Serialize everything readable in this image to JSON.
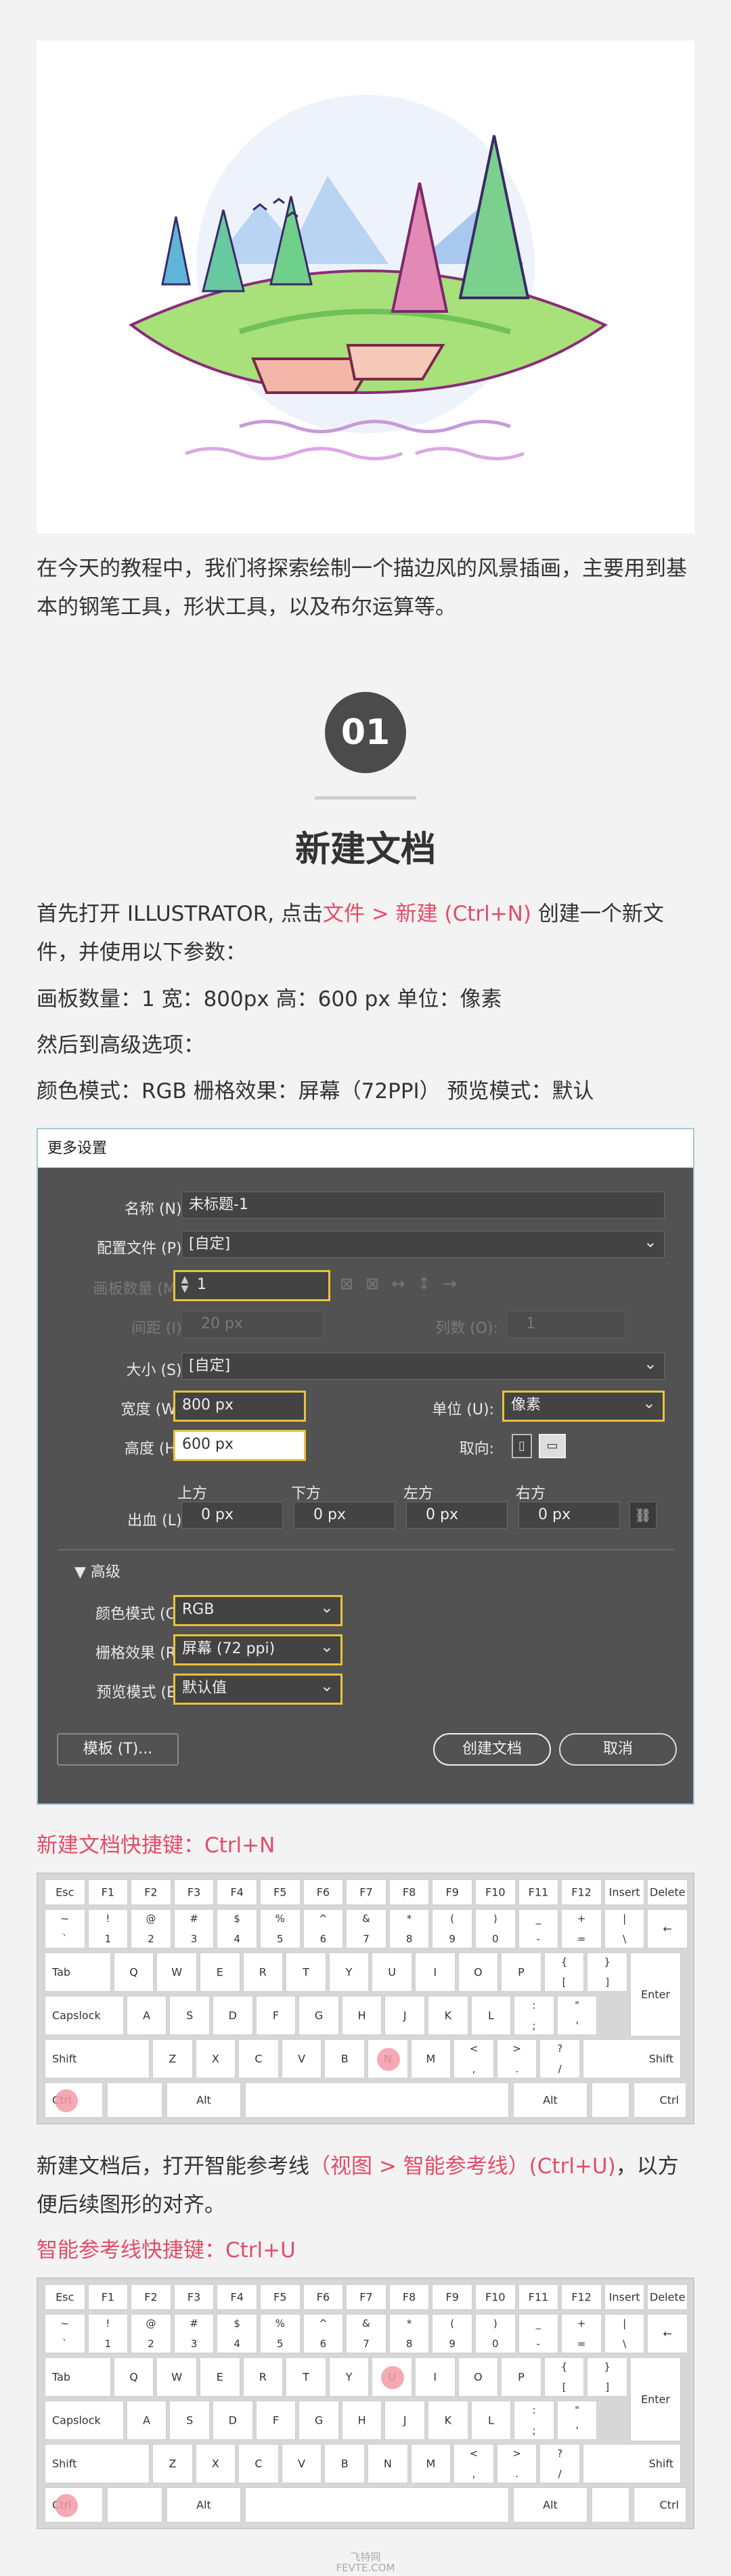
{
  "intro": "在今天的教程中，我们将探索绘制一个描边风的风景插画，主要用到基本的钢笔工具，形状工具，以及布尔运算等。",
  "step": {
    "number": "01",
    "title": "新建文档"
  },
  "para1": {
    "a": "首先打开 ILLUSTRATOR, 点击",
    "link": "文件 > 新建 (Ctrl+N)",
    "b": " 创建一个新文件，并使用以下参数："
  },
  "para2": "画板数量：1   宽：800px   高：600 px   单位：像素",
  "para3": "然后到高级选项：",
  "para4": "颜色模式：RGB   栅格效果：屏幕（72PPI）  预览模式：默认",
  "dialog": {
    "title": "更多设置",
    "name_label": "名称 (N):",
    "name_value": "未标题-1",
    "profile_label": "配置文件 (P):",
    "profile_value": "[自定]",
    "artboards_label": "画板数量 (M):",
    "artboards_value": "1",
    "spacing_label": "间距 (I):",
    "spacing_value": "20 px",
    "columns_label": "列数 (O):",
    "columns_value": "1",
    "size_label": "大小 (S):",
    "size_value": "[自定]",
    "width_label": "宽度 (W):",
    "width_value": "800 px",
    "units_label": "单位 (U):",
    "units_value": "像素",
    "height_label": "高度 (H):",
    "height_value": "600 px",
    "orientation_label": "取向:",
    "bleed_label": "出血 (L):",
    "bleed_top": "上方",
    "bleed_bottom": "下方",
    "bleed_left": "左方",
    "bleed_right": "右方",
    "bleed_value": "0 px",
    "advanced": "高级",
    "color_label": "颜色模式 (C):",
    "color_value": "RGB",
    "raster_label": "栅格效果 (R):",
    "raster_value": "屏幕 (72 ppi)",
    "preview_label": "预览模式 (E):",
    "preview_value": "默认值",
    "template_btn": "模板 (T)...",
    "create_btn": "创建文档",
    "cancel_btn": "取消"
  },
  "shortcut1": "新建文档快捷键：Ctrl+N",
  "para5": {
    "a": "新建文档后，打开智能参考线",
    "link": "（视图 > 智能参考线）(Ctrl+U)",
    "b": "，以方便后续图形的对齐。"
  },
  "shortcut2": "智能参考线快捷键：Ctrl+U",
  "keyboard": {
    "row1": [
      "Esc",
      "F1",
      "F2",
      "F3",
      "F4",
      "F5",
      "F6",
      "F7",
      "F8",
      "F9",
      "F10",
      "F11",
      "F12",
      "Insert",
      "Delete"
    ],
    "row2": [
      [
        "~",
        "`"
      ],
      [
        "!",
        "1"
      ],
      [
        "@",
        "2"
      ],
      [
        "#",
        "3"
      ],
      [
        "$",
        "4"
      ],
      [
        "%",
        "5"
      ],
      [
        "^",
        "6"
      ],
      [
        "&",
        "7"
      ],
      [
        "*",
        "8"
      ],
      [
        "(",
        "9"
      ],
      [
        ")",
        "0"
      ],
      [
        "_",
        "-"
      ],
      [
        "+",
        "="
      ],
      [
        "|",
        "\\"
      ]
    ],
    "backspace": "←",
    "tab": "Tab",
    "row3": [
      "Q",
      "W",
      "E",
      "R",
      "T",
      "Y",
      "U",
      "I",
      "O",
      "P"
    ],
    "row3b": [
      [
        "{",
        "["
      ],
      [
        "}",
        "]"
      ]
    ],
    "caps": "Capslock",
    "row4": [
      "A",
      "S",
      "D",
      "F",
      "G",
      "H",
      "J",
      "K",
      "L"
    ],
    "row4b": [
      [
        ":",
        ";"
      ],
      [
        "\"",
        "'"
      ]
    ],
    "enter": "Enter",
    "shift": "Shift",
    "row5": [
      "Z",
      "X",
      "C",
      "V",
      "B",
      "N",
      "M"
    ],
    "row5b": [
      [
        "<",
        ","
      ],
      [
        ">",
        "."
      ],
      [
        "?",
        "/"
      ]
    ],
    "ctrl": "Ctrl",
    "alt": "Alt"
  },
  "footer": {
    "line1": "飞特网",
    "line2": "FEVTE.COM"
  },
  "colors": {
    "accent": "#e24d67",
    "dialog_bg": "#525252",
    "highlight": "#e8c33a"
  }
}
